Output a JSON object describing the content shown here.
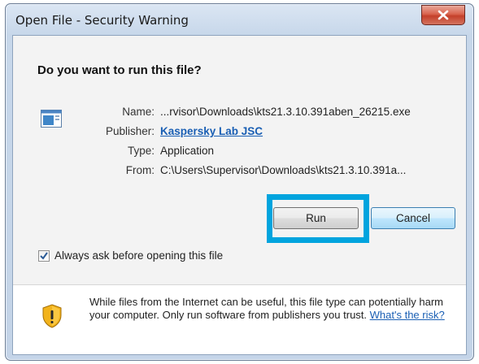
{
  "window": {
    "title": "Open File - Security Warning"
  },
  "dialog": {
    "question": "Do you want to run this file?",
    "fields": [
      {
        "label": "Name:",
        "value": "...rvisor\\Downloads\\kts21.3.10.391aben_26215.exe"
      },
      {
        "label": "Publisher:",
        "value": "Kaspersky Lab JSC"
      },
      {
        "label": "Type:",
        "value": "Application"
      },
      {
        "label": "From:",
        "value": "C:\\Users\\Supervisor\\Downloads\\kts21.3.10.391a..."
      }
    ],
    "run_label": "Run",
    "cancel_label": "Cancel",
    "always_ask_label": "Always ask before opening this file",
    "always_ask_checked": true,
    "warning_text": "While files from the Internet can be useful, this file type can potentially harm your computer. Only run software from publishers you trust.",
    "risk_link": "What's the risk?"
  },
  "colors": {
    "highlight": "#00a4de",
    "link": "#1a5fb4"
  }
}
